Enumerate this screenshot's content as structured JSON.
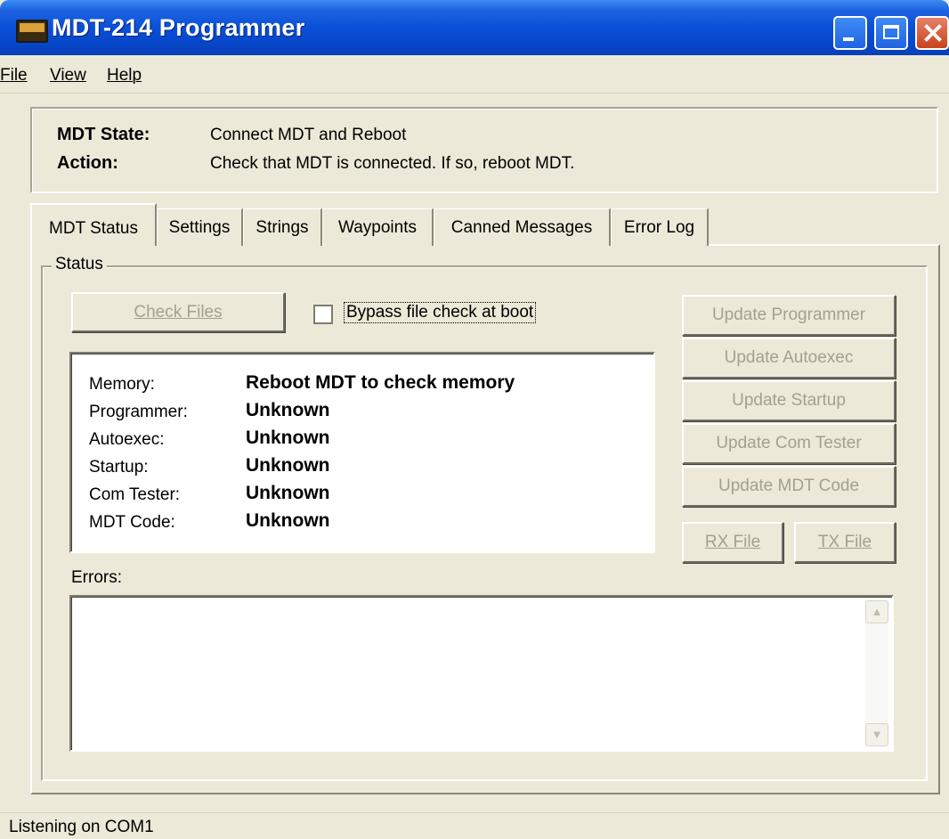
{
  "window": {
    "title": "MDT-214 Programmer",
    "icon": "terminal-icon"
  },
  "menu": [
    {
      "label": "File"
    },
    {
      "label": "View"
    },
    {
      "label": "Help"
    }
  ],
  "info": {
    "state_label": "MDT State:",
    "state_value": "Connect MDT and Reboot",
    "action_label": "Action:",
    "action_value": "Check that MDT is connected. If so, reboot MDT."
  },
  "tabs": [
    {
      "label": "MDT Status",
      "active": true
    },
    {
      "label": "Settings"
    },
    {
      "label": "Strings"
    },
    {
      "label": "Waypoints"
    },
    {
      "label": "Canned Messages"
    },
    {
      "label": "Error Log"
    }
  ],
  "status_group": {
    "label": "Status",
    "check_files_button": "Check Files",
    "bypass_label": "Bypass file check at boot",
    "bypass_checked": false,
    "rows": [
      {
        "label": "Memory:",
        "value": "Reboot MDT to check memory"
      },
      {
        "label": "Programmer:",
        "value": "Unknown"
      },
      {
        "label": "Autoexec:",
        "value": "Unknown"
      },
      {
        "label": "Startup:",
        "value": "Unknown"
      },
      {
        "label": "Com Tester:",
        "value": "Unknown"
      },
      {
        "label": "MDT Code:",
        "value": "Unknown"
      }
    ],
    "update_buttons": [
      "Update Programmer",
      "Update Autoexec",
      "Update Startup",
      "Update Com Tester",
      "Update MDT Code"
    ],
    "rx_button": "RX File",
    "tx_button": "TX File",
    "errors_label": "Errors:",
    "errors_text": ""
  },
  "statusbar": {
    "text": "Listening on COM1"
  },
  "colors": {
    "title_bar": "#0a4fd8",
    "face": "#ece9d8",
    "disabled_text": "#a3a08f"
  }
}
